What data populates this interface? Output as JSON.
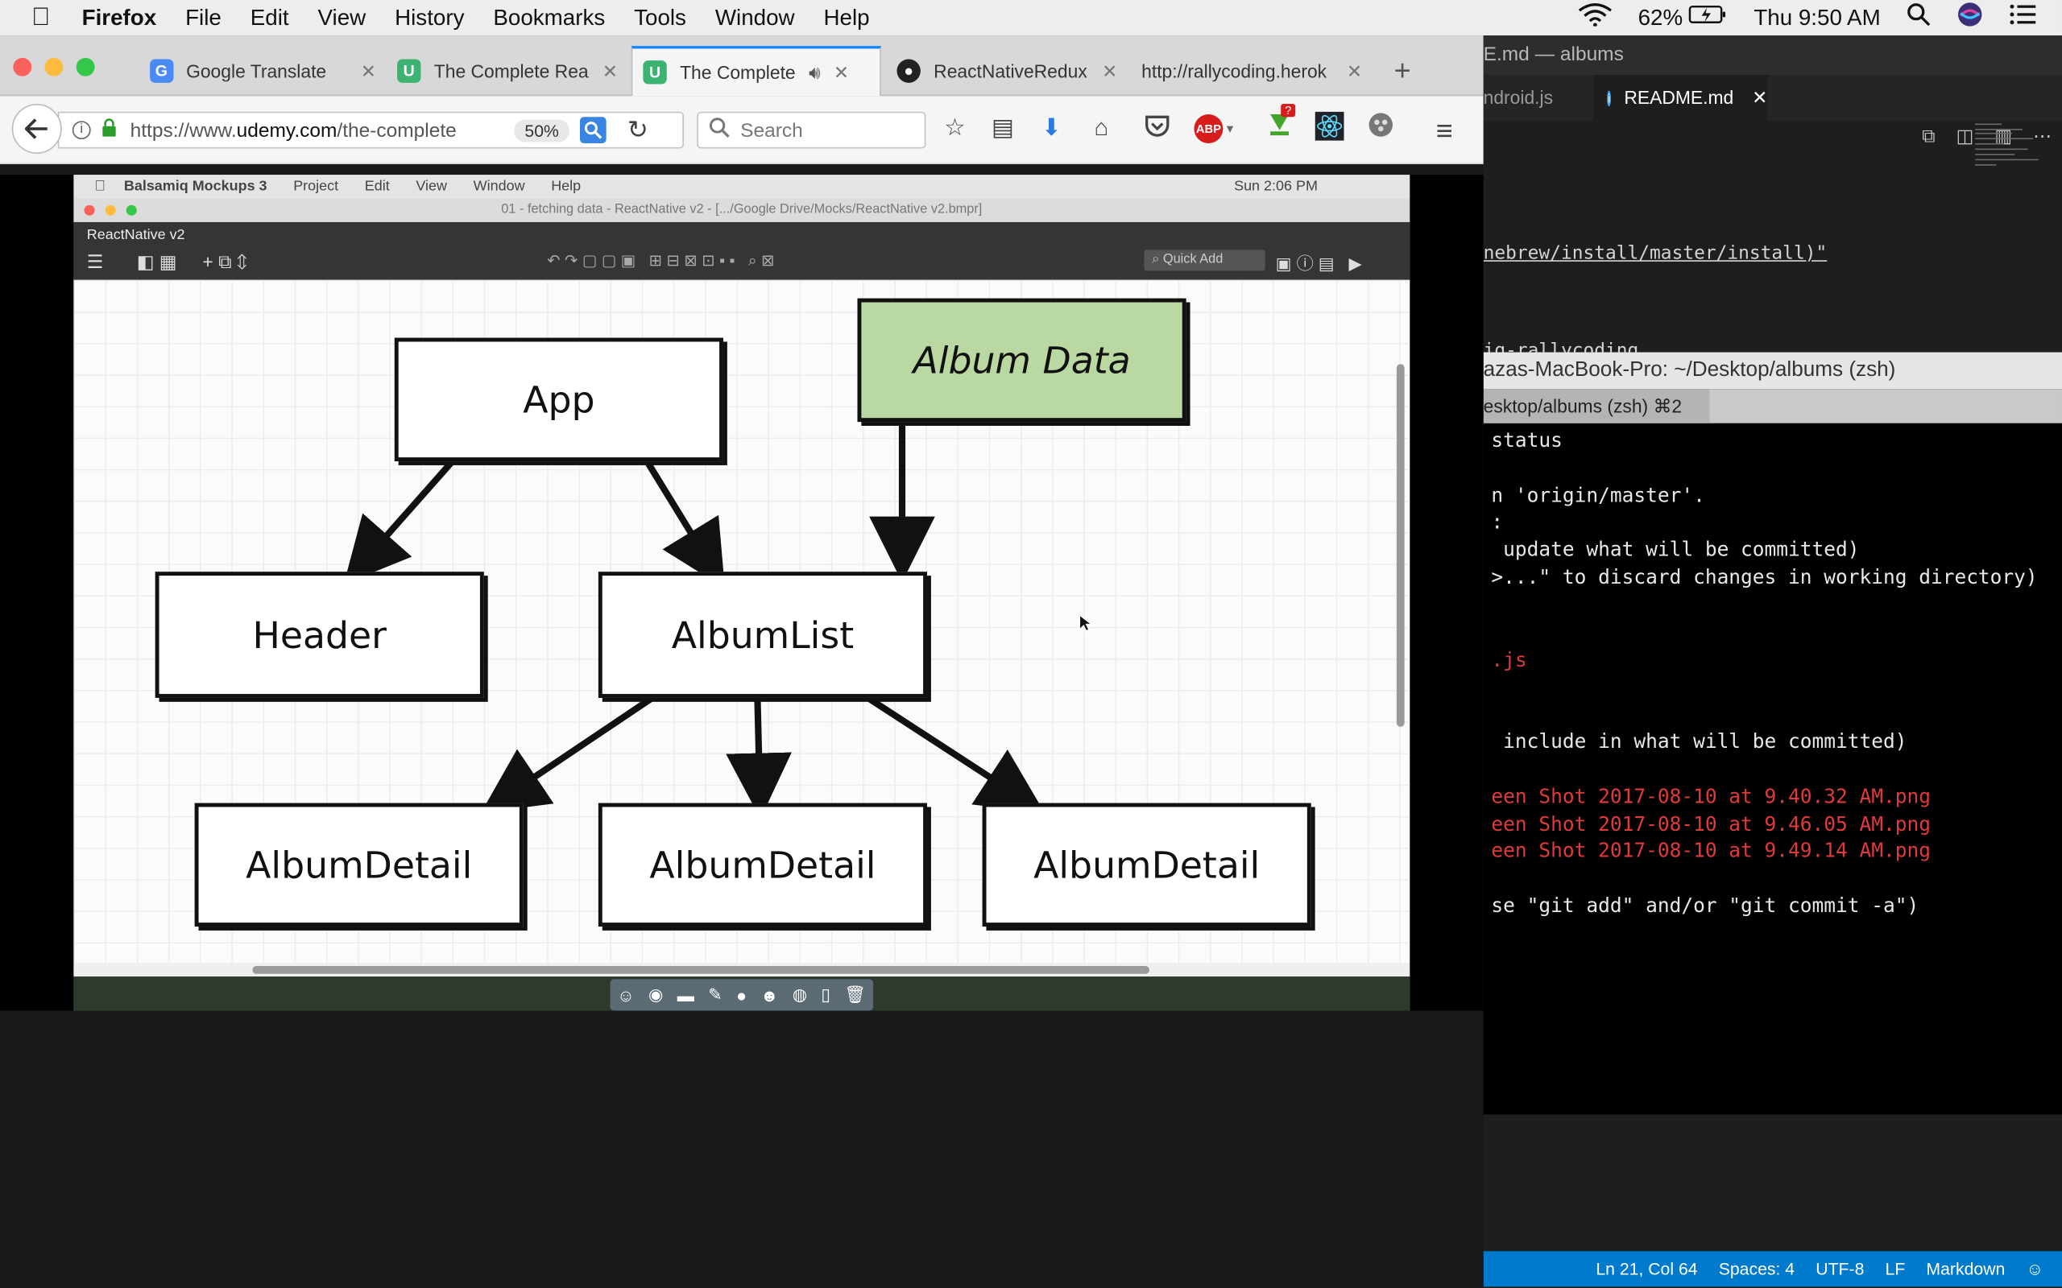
{
  "menubar": {
    "apple": "",
    "app": "Firefox",
    "items": [
      "File",
      "Edit",
      "View",
      "History",
      "Bookmarks",
      "Tools",
      "Window",
      "Help"
    ],
    "battery": "62%",
    "clock": "Thu 9:50 AM"
  },
  "firefox": {
    "tabs": [
      {
        "title": "Google Translate",
        "favicon": "G"
      },
      {
        "title": "The Complete Rea",
        "favicon": "U"
      },
      {
        "title": "The Complete",
        "favicon": "U"
      },
      {
        "title": "ReactNativeRedux",
        "favicon": "gh"
      },
      {
        "title": "http://rallycoding.herok",
        "favicon": ""
      }
    ],
    "new_tab": "+",
    "url_prefix": "https://www.",
    "url_domain": "udemy.com",
    "url_rest": "/the-complete",
    "zoom": "50%",
    "search_placeholder": "Search",
    "abp": "ABP",
    "badge": "?"
  },
  "balsamiq": {
    "menu": [
      "Balsamiq Mockups 3",
      "Project",
      "Edit",
      "View",
      "Window",
      "Help"
    ],
    "clock": "Sun 2:06 PM",
    "title": "01 - fetching data - ReactNative v2 - [.../Google Drive/Mocks/ReactNative v2.bmpr]",
    "project": "ReactNative v2",
    "quick_add": "Quick Add",
    "diagram": {
      "app": "App",
      "album_data": "Album Data",
      "header": "Header",
      "album_list": "AlbumList",
      "detail_1": "AlbumDetail",
      "detail_2": "AlbumDetail",
      "detail_3": "AlbumDetail"
    }
  },
  "vscode": {
    "title": "E.md — albums",
    "tab_inactive": "ndroid.js",
    "tab_active": "README.md",
    "code_line": "nebrew/install/master/install)\"",
    "code_line2": "ig-rallycoding",
    "status": {
      "position": "Ln 21, Col 64",
      "spaces": "Spaces: 4",
      "encoding": "UTF-8",
      "eol": "LF",
      "lang": "Markdown"
    }
  },
  "terminal": {
    "title": "azas-MacBook-Pro: ~/Desktop/albums (zsh)",
    "tab": "esktop/albums (zsh)  ⌘2",
    "lines": [
      {
        "text": "status",
        "red": false
      },
      {
        "text": "n 'origin/master'.",
        "red": false
      },
      {
        "text": ":",
        "red": false
      },
      {
        "text": " update what will be committed)",
        "red": false
      },
      {
        "text": ">...\" to discard changes in working directory)",
        "red": false
      },
      {
        "text": ".js",
        "red": true
      },
      {
        "text": " include in what will be committed)",
        "red": false
      },
      {
        "text": "een Shot 2017-08-10 at 9.40.32 AM.png",
        "red": true
      },
      {
        "text": "een Shot 2017-08-10 at 9.46.05 AM.png",
        "red": true
      },
      {
        "text": "een Shot 2017-08-10 at 9.49.14 AM.png",
        "red": true
      },
      {
        "text": "se \"git add\" and/or \"git commit -a\")",
        "red": false
      }
    ]
  }
}
